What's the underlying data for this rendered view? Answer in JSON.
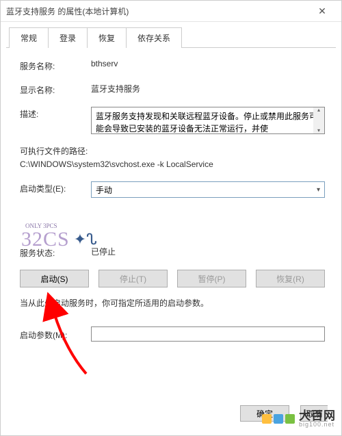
{
  "titlebar": {
    "title": "蓝牙支持服务 的属性(本地计算机)",
    "close": "✕"
  },
  "tabs": {
    "t0": "常规",
    "t1": "登录",
    "t2": "恢复",
    "t3": "依存关系"
  },
  "labels": {
    "service_name": "服务名称:",
    "display_name": "显示名称:",
    "description": "描述:",
    "exec_path_label": "可执行文件的路径:",
    "startup_type": "启动类型(E):",
    "service_status": "服务状态:",
    "note": "当从此处启动服务时，你可指定所适用的启动参数。",
    "start_param": "启动参数(M):"
  },
  "values": {
    "service_name": "bthserv",
    "display_name": "蓝牙支持服务",
    "description": "蓝牙服务支持发现和关联远程蓝牙设备。停止或禁用此服务可能会导致已安装的蓝牙设备无法正常运行，并使",
    "exec_path": "C:\\WINDOWS\\system32\\svchost.exe -k LocalService",
    "startup_type": "手动",
    "service_status": "已停止",
    "start_param": ""
  },
  "buttons": {
    "start": "启动(S)",
    "stop": "停止(T)",
    "pause": "暂停(P)",
    "resume": "恢复(R)",
    "ok": "确定",
    "cancel": "取消"
  },
  "watermark": {
    "text": "32CS",
    "sub": "ONLY 3PCS"
  },
  "brand": {
    "name": "大百网",
    "url": "big100.net",
    "colors": {
      "c1": "#ffbf3f",
      "c2": "#4aa3e0",
      "c3": "#7ac142"
    }
  }
}
